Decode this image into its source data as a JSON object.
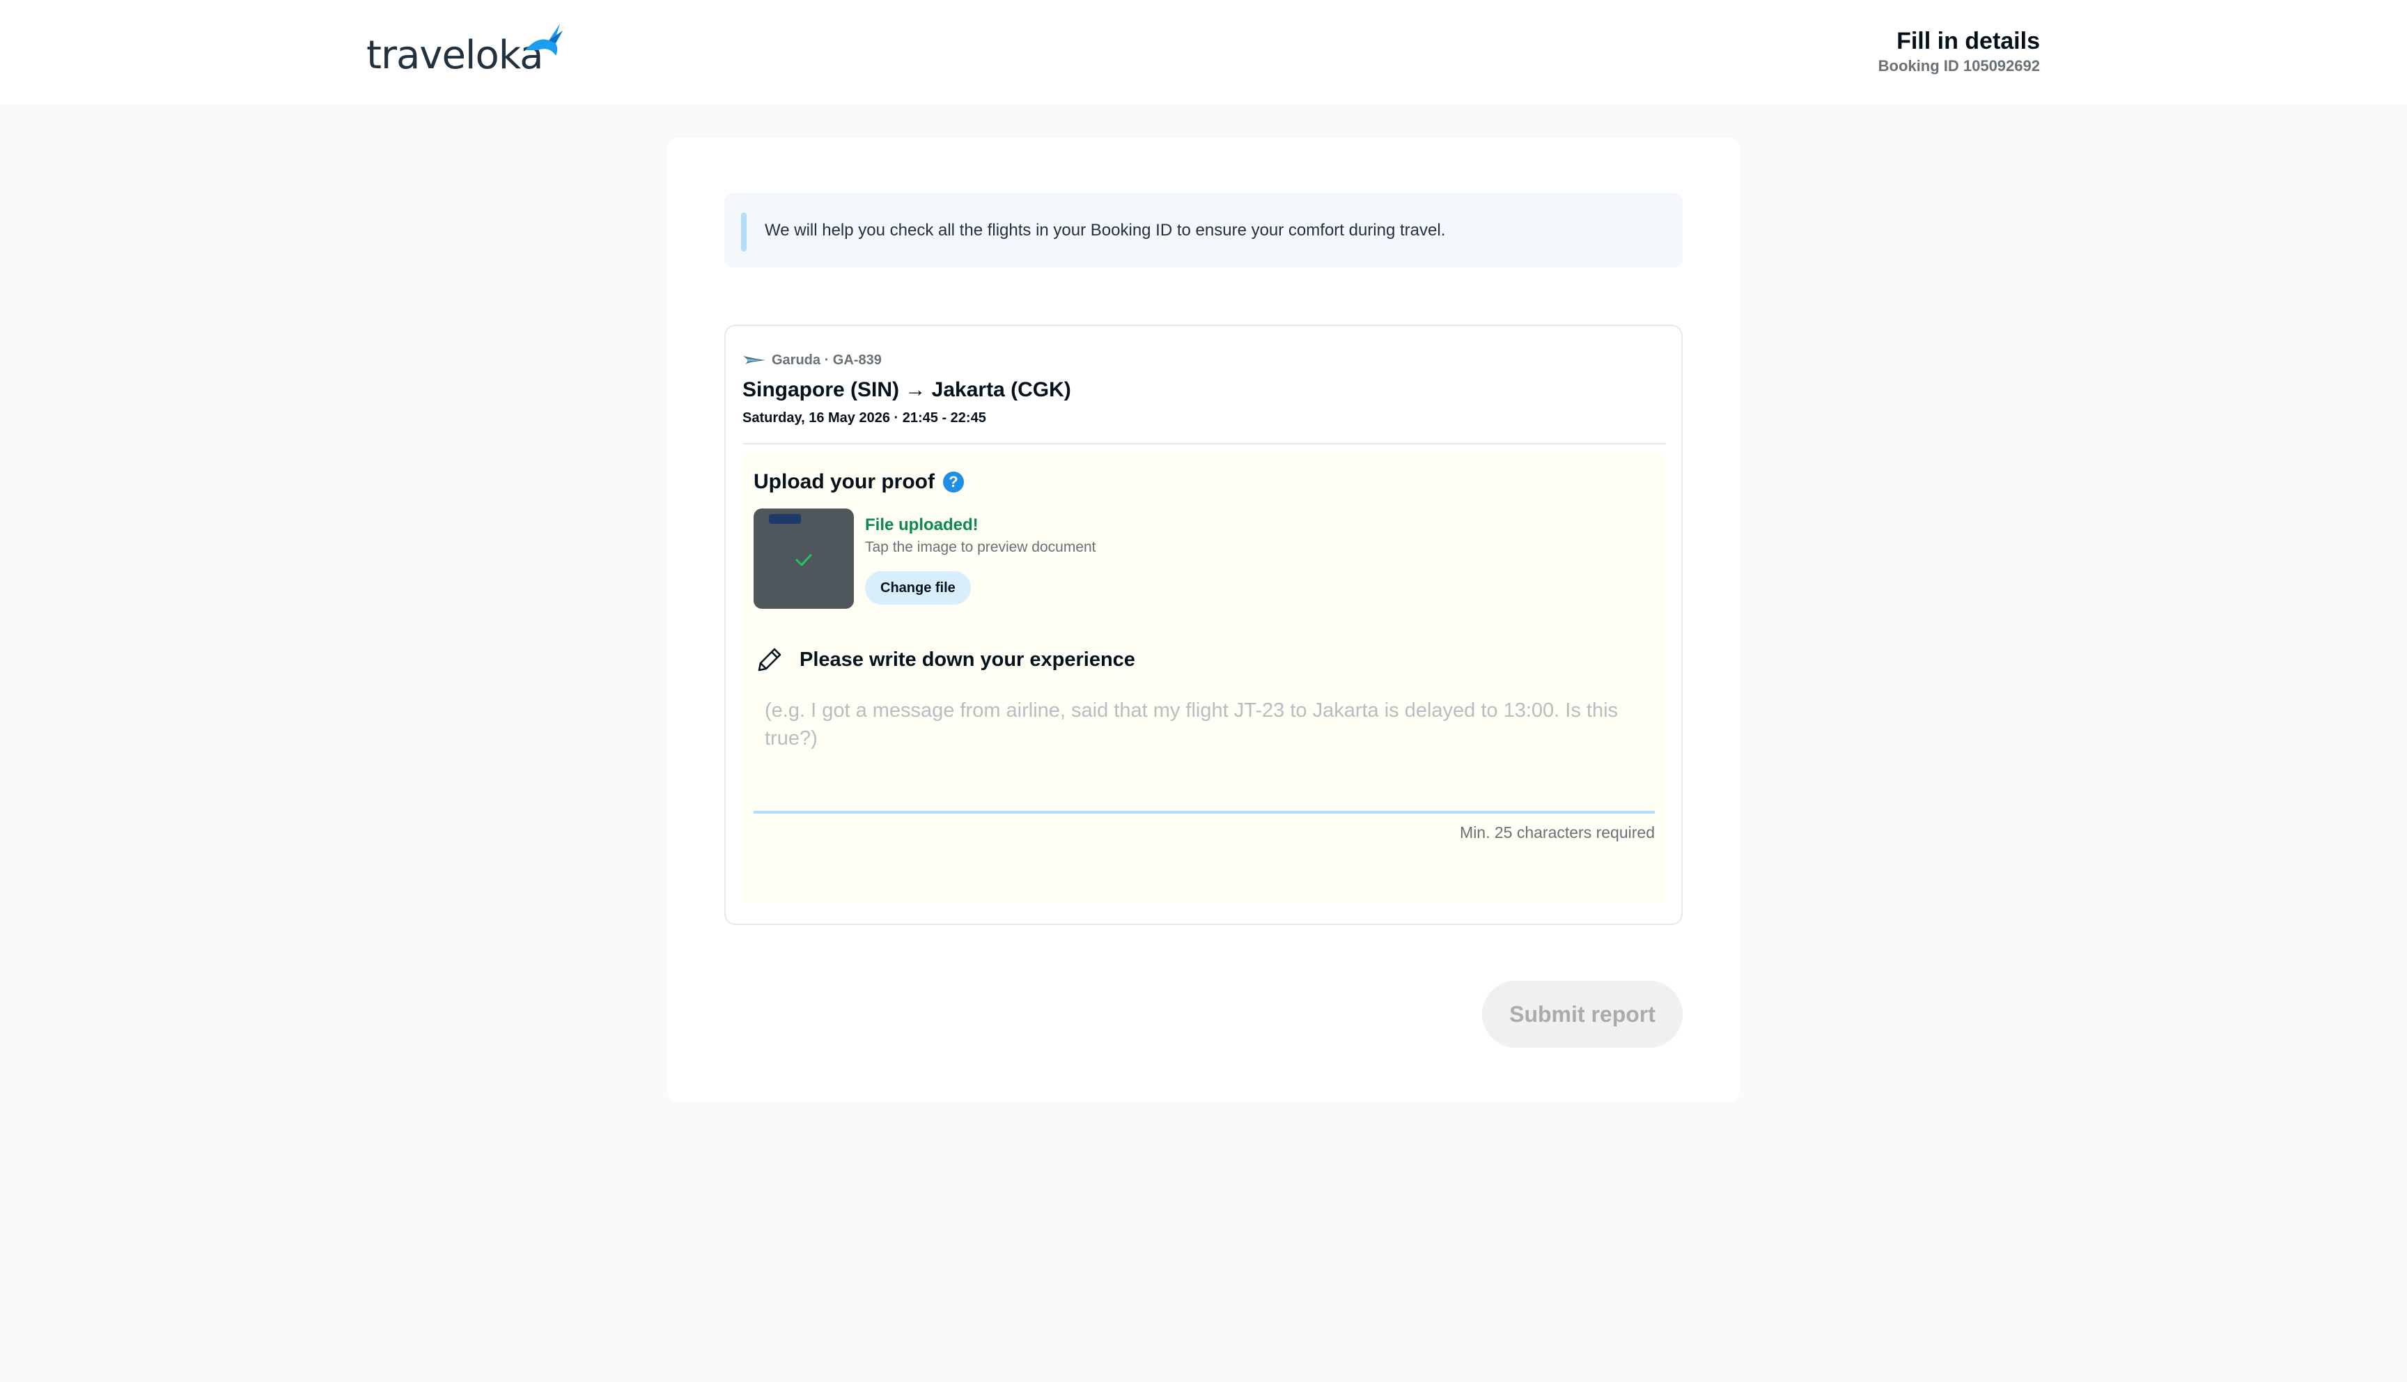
{
  "header": {
    "logo_text": "traveloka",
    "title": "Fill in details",
    "booking_id": "Booking ID 105092692"
  },
  "info_banner": {
    "text": "We will help you check all the flights in your Booking ID to ensure your comfort during travel."
  },
  "flight": {
    "airline": "Garuda · GA-839",
    "route": "Singapore (SIN) → Jakarta (CGK)",
    "datetime": "Saturday, 16 May 2026 · 21:45 - 22:45"
  },
  "upload": {
    "title": "Upload your proof",
    "help_icon": "question-mark-icon",
    "status": "File uploaded!",
    "hint": "Tap the image to preview document",
    "change_label": "Change file"
  },
  "experience": {
    "title": "Please write down your experience",
    "placeholder": "(e.g. I got a message from airline, said that my flight JT-23 to Jakarta is delayed to 13:00. Is this true?)",
    "value": "",
    "min_chars": "Min. 25 characters required"
  },
  "submit": {
    "label": "Submit report"
  },
  "colors": {
    "brand_blue": "#1f8fe6",
    "success_green": "#0b8a4c",
    "disabled_gray": "#a9acaf"
  }
}
